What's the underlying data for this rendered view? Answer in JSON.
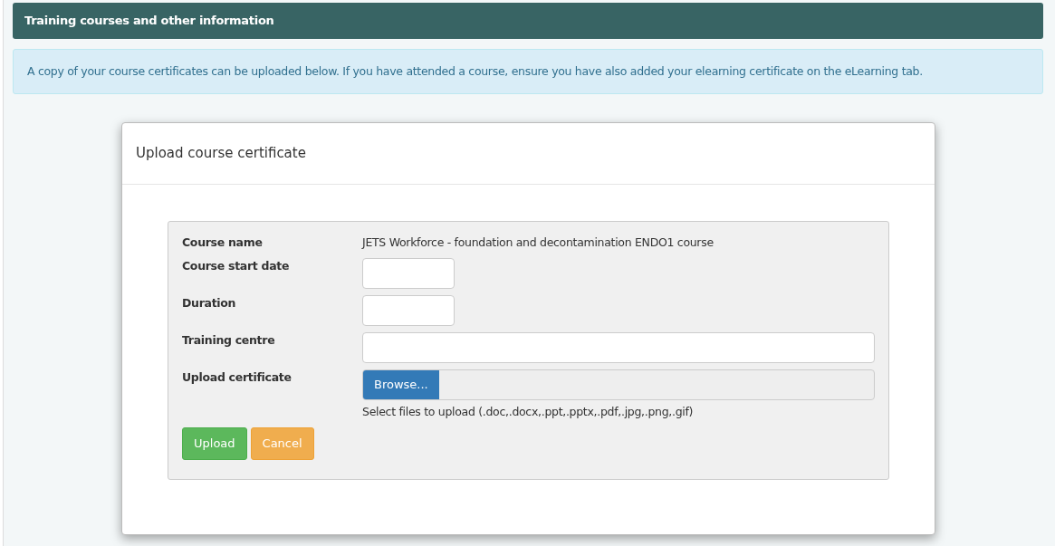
{
  "panel": {
    "title": "Training courses and other information"
  },
  "info_message": "A copy of your course certificates can be uploaded below. If you have attended a course, ensure you have also added your elearning certificate on the eLearning tab.",
  "dialog": {
    "title": "Upload course certificate",
    "fields": [
      {
        "kind": "text",
        "label": "Course name",
        "value": "JETS Workforce - foundation and decontamination ENDO1 course"
      },
      {
        "kind": "short-input",
        "label": "Course start date"
      },
      {
        "kind": "short-input",
        "label": "Duration"
      },
      {
        "kind": "wide-input",
        "label": "Training centre"
      },
      {
        "kind": "file",
        "label": "Upload certificate",
        "button": "Browse...",
        "hint": "Select files to upload (.doc,.docx,.ppt,.pptx,.pdf,.jpg,.png,.gif)"
      }
    ],
    "buttons": [
      {
        "kind": "primary",
        "label": "Upload"
      },
      {
        "kind": "cancel",
        "label": "Cancel"
      }
    ]
  }
}
